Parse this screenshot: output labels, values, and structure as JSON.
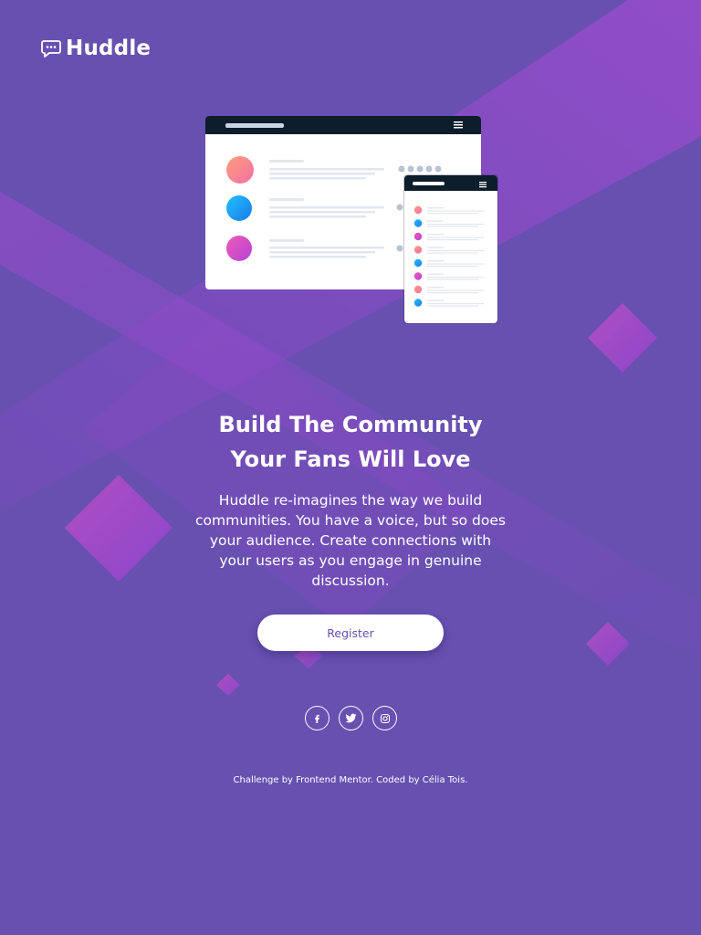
{
  "brand": {
    "name": "Huddle",
    "logo_icon": "speech-bubble-icon"
  },
  "hero": {
    "headline_line1": "Build The Community",
    "headline_line2": "Your Fans Will Love",
    "description": "Huddle re-imagines the way we build communities. You have a voice, but so does your audience. Create connections with your users as you engage in genuine discussion.",
    "register_label": "Register",
    "illustration": "desktop-and-mobile-mockup-illustration"
  },
  "social": [
    {
      "name": "facebook",
      "icon": "facebook-icon"
    },
    {
      "name": "twitter",
      "icon": "twitter-icon"
    },
    {
      "name": "instagram",
      "icon": "instagram-icon"
    }
  ],
  "footer": {
    "prefix": "Challenge by ",
    "challenge_link": "Frontend Mentor",
    "middle": ". Coded by ",
    "author_link": "Célia Tois",
    "suffix": "."
  },
  "colors": {
    "background": "#6750b0",
    "accent_shape": "#9a4ccf",
    "button_text": "#6750b0",
    "mockup_header": "#0c1d2b"
  }
}
